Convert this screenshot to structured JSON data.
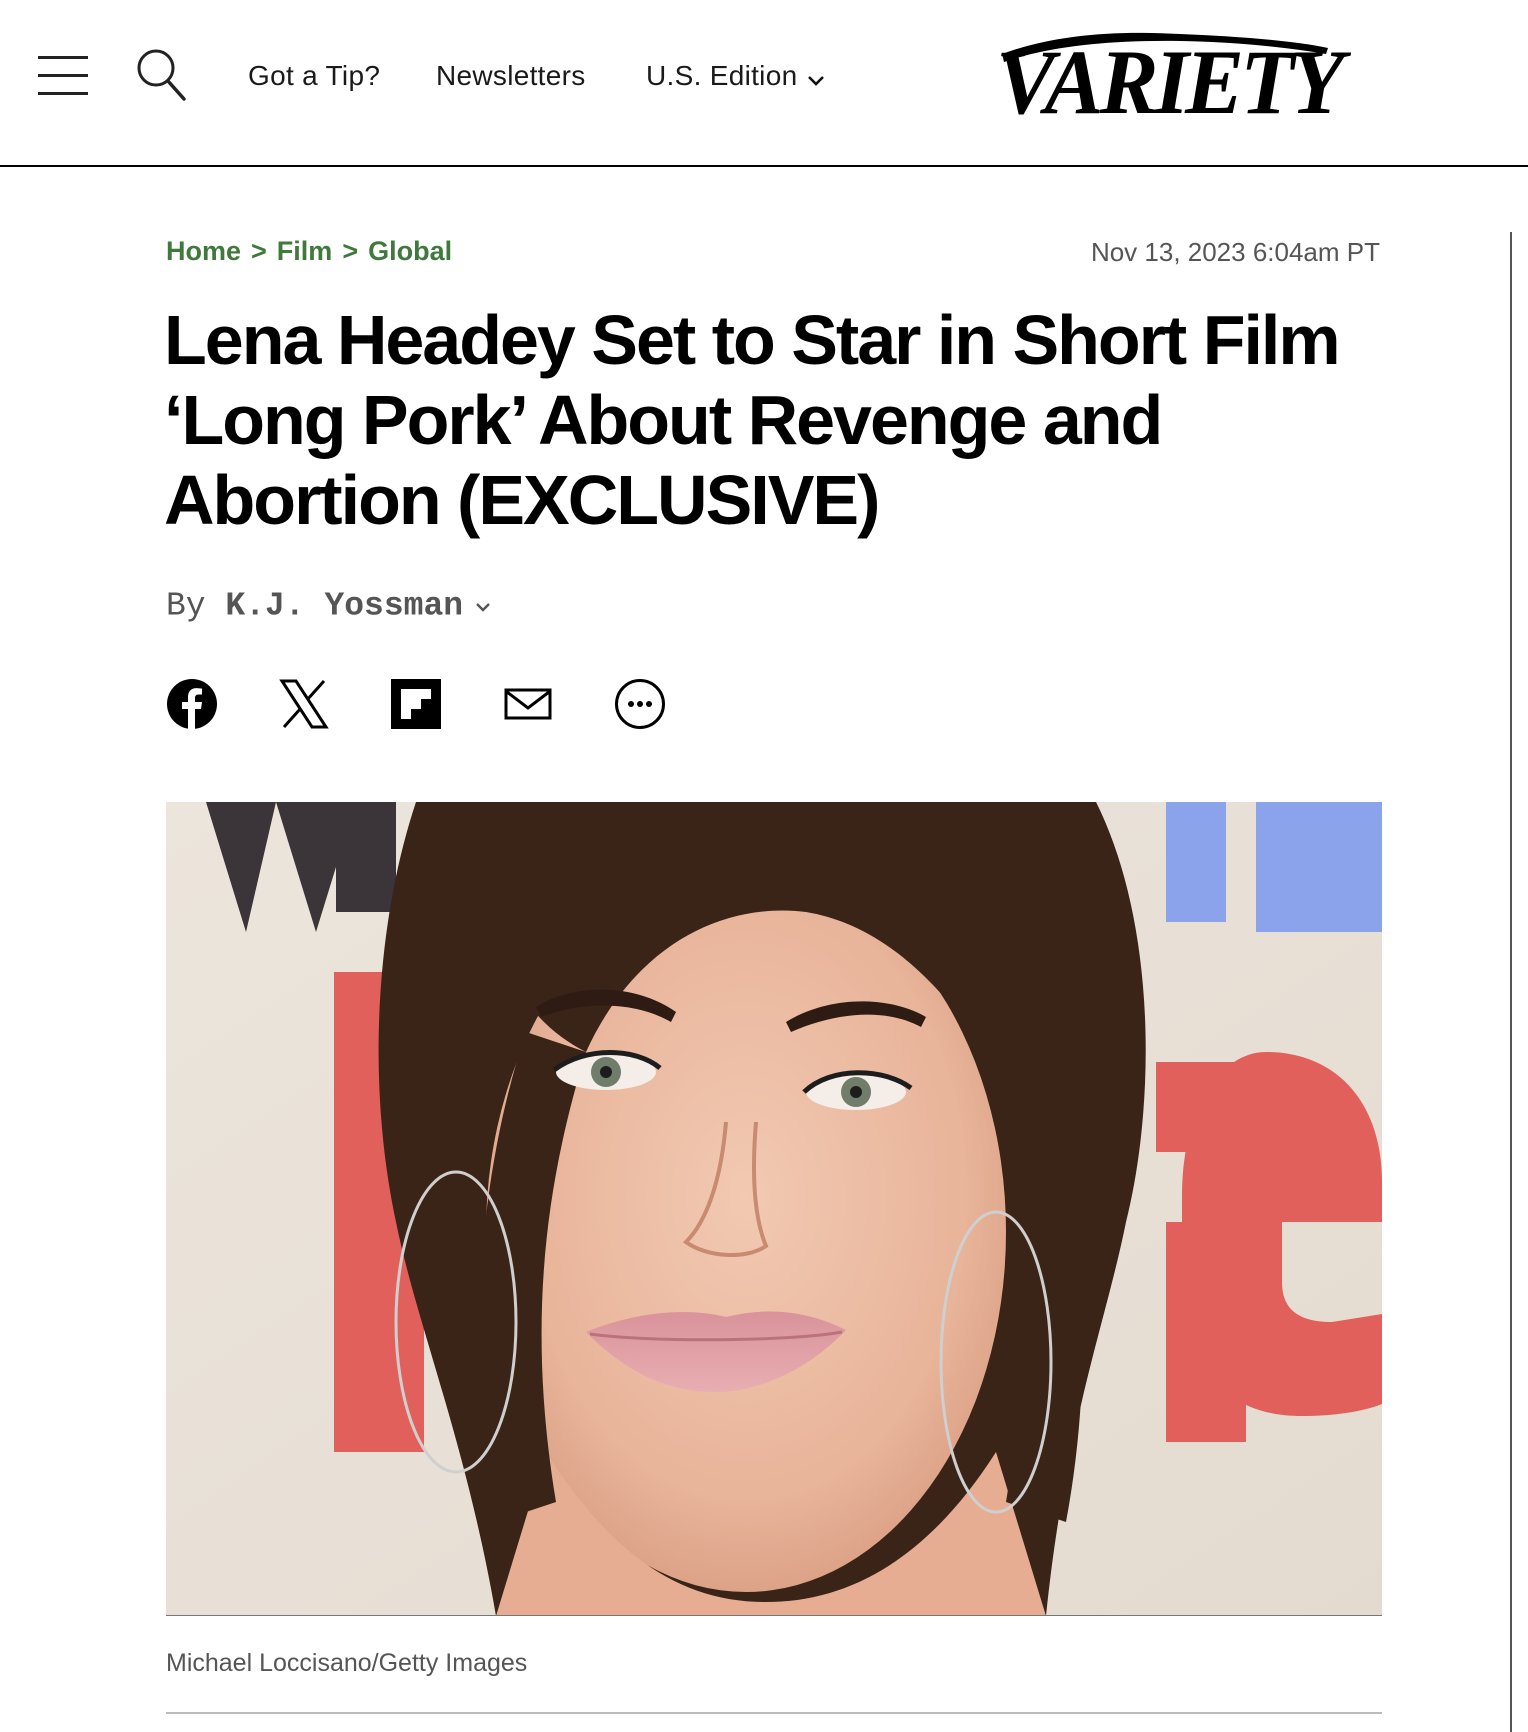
{
  "header": {
    "menu_icon": "hamburger-menu-icon",
    "search_icon": "search-icon",
    "nav_tip": "Got a Tip?",
    "nav_newsletters": "Newsletters",
    "nav_edition": "U.S. Edition",
    "logo": "VARIETY"
  },
  "breadcrumb": {
    "home": "Home",
    "film": "Film",
    "global": "Global",
    "separator": ">"
  },
  "article": {
    "timestamp": "Nov 13, 2023 6:04am PT",
    "headline": "Lena Headey Set to Star in Short Film ‘Long Pork’ About Revenge and Abortion (EXCLUSIVE)",
    "byline_prefix": "By",
    "author": "K.J. Yossman",
    "photo_credit": "Michael Loccisano/Getty Images"
  },
  "share": {
    "icons": [
      "facebook-icon",
      "x-icon",
      "flipboard-icon",
      "email-icon",
      "more-icon"
    ]
  },
  "colors": {
    "breadcrumb_green": "#3f7a3c",
    "meta_gray": "#555555",
    "backdrop_red": "#e2605b",
    "backdrop_blue": "#8aa3ea",
    "hair_brown": "#3a2418"
  }
}
